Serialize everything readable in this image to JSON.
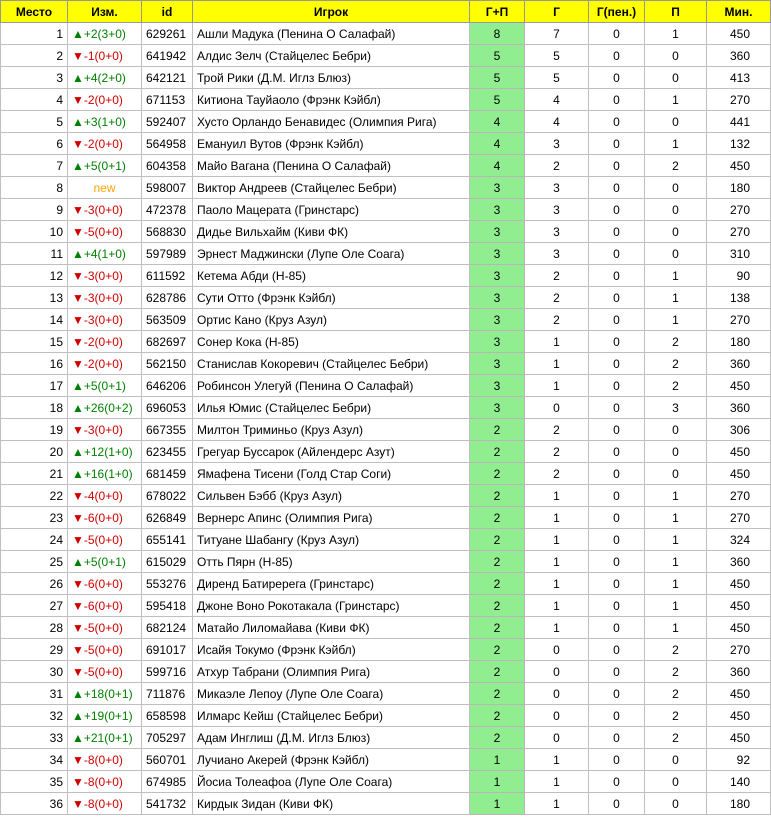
{
  "headers": {
    "place": "Место",
    "change": "Изм.",
    "id": "id",
    "player": "Игрок",
    "gp": "Г+П",
    "g": "Г",
    "gpen": "Г(пен.)",
    "p": "П",
    "min": "Мин."
  },
  "colors": {
    "header_bg": "#ffff00",
    "gp_bg": "#90ee90",
    "up": "#008000",
    "down": "#d00000",
    "new": "#ffa500"
  },
  "rows": [
    {
      "place": "1",
      "dir": "up",
      "change": "▲+2(3+0)",
      "id": "629261",
      "player": "Ашли Мадука (Пенина О Салафай)",
      "gp": "8",
      "g": "7",
      "gpen": "0",
      "p": "1",
      "min": "450"
    },
    {
      "place": "2",
      "dir": "down",
      "change": "▼-1(0+0)",
      "id": "641942",
      "player": "Алдис Зелч (Стайцелес Бебри)",
      "gp": "5",
      "g": "5",
      "gpen": "0",
      "p": "0",
      "min": "360"
    },
    {
      "place": "3",
      "dir": "up",
      "change": "▲+4(2+0)",
      "id": "642121",
      "player": "Трой Рики (Д.М. Иглз Блюз)",
      "gp": "5",
      "g": "5",
      "gpen": "0",
      "p": "0",
      "min": "413"
    },
    {
      "place": "4",
      "dir": "down",
      "change": "▼-2(0+0)",
      "id": "671153",
      "player": "Китиона Тауйаоло (Фрэнк Кэйбл)",
      "gp": "5",
      "g": "4",
      "gpen": "0",
      "p": "1",
      "min": "270"
    },
    {
      "place": "5",
      "dir": "up",
      "change": "▲+3(1+0)",
      "id": "592407",
      "player": "Хусто Орландо Бенавидес (Олимпия Рига)",
      "gp": "4",
      "g": "4",
      "gpen": "0",
      "p": "0",
      "min": "441"
    },
    {
      "place": "6",
      "dir": "down",
      "change": "▼-2(0+0)",
      "id": "564958",
      "player": "Емануил Вутов (Фрэнк Кэйбл)",
      "gp": "4",
      "g": "3",
      "gpen": "0",
      "p": "1",
      "min": "132"
    },
    {
      "place": "7",
      "dir": "up",
      "change": "▲+5(0+1)",
      "id": "604358",
      "player": "Майо Вагана (Пенина О Салафай)",
      "gp": "4",
      "g": "2",
      "gpen": "0",
      "p": "2",
      "min": "450"
    },
    {
      "place": "8",
      "dir": "new",
      "change": "new",
      "id": "598007",
      "player": "Виктор Андреев (Стайцелес Бебри)",
      "gp": "3",
      "g": "3",
      "gpen": "0",
      "p": "0",
      "min": "180"
    },
    {
      "place": "9",
      "dir": "down",
      "change": "▼-3(0+0)",
      "id": "472378",
      "player": "Паоло Мацерата (Гринстарс)",
      "gp": "3",
      "g": "3",
      "gpen": "0",
      "p": "0",
      "min": "270"
    },
    {
      "place": "10",
      "dir": "down",
      "change": "▼-5(0+0)",
      "id": "568830",
      "player": "Дидье Вильхайм (Киви ФК)",
      "gp": "3",
      "g": "3",
      "gpen": "0",
      "p": "0",
      "min": "270"
    },
    {
      "place": "11",
      "dir": "up",
      "change": "▲+4(1+0)",
      "id": "597989",
      "player": "Эрнест Маджински (Лупе Оле Соага)",
      "gp": "3",
      "g": "3",
      "gpen": "0",
      "p": "0",
      "min": "310"
    },
    {
      "place": "12",
      "dir": "down",
      "change": "▼-3(0+0)",
      "id": "611592",
      "player": "Кетема Абди (Н-85)",
      "gp": "3",
      "g": "2",
      "gpen": "0",
      "p": "1",
      "min": "90"
    },
    {
      "place": "13",
      "dir": "down",
      "change": "▼-3(0+0)",
      "id": "628786",
      "player": "Сути Отто (Фрэнк Кэйбл)",
      "gp": "3",
      "g": "2",
      "gpen": "0",
      "p": "1",
      "min": "138"
    },
    {
      "place": "14",
      "dir": "down",
      "change": "▼-3(0+0)",
      "id": "563509",
      "player": "Ортис Кано (Круз Азул)",
      "gp": "3",
      "g": "2",
      "gpen": "0",
      "p": "1",
      "min": "270"
    },
    {
      "place": "15",
      "dir": "down",
      "change": "▼-2(0+0)",
      "id": "682697",
      "player": "Сонер Кока (Н-85)",
      "gp": "3",
      "g": "1",
      "gpen": "0",
      "p": "2",
      "min": "180"
    },
    {
      "place": "16",
      "dir": "down",
      "change": "▼-2(0+0)",
      "id": "562150",
      "player": "Станислав Кокоревич (Стайцелес Бебри)",
      "gp": "3",
      "g": "1",
      "gpen": "0",
      "p": "2",
      "min": "360"
    },
    {
      "place": "17",
      "dir": "up",
      "change": "▲+5(0+1)",
      "id": "646206",
      "player": "Робинсон Улегуй (Пенина О Салафай)",
      "gp": "3",
      "g": "1",
      "gpen": "0",
      "p": "2",
      "min": "450"
    },
    {
      "place": "18",
      "dir": "up",
      "change": "▲+26(0+2)",
      "id": "696053",
      "player": "Илья Юмис (Стайцелес Бебри)",
      "gp": "3",
      "g": "0",
      "gpen": "0",
      "p": "3",
      "min": "360"
    },
    {
      "place": "19",
      "dir": "down",
      "change": "▼-3(0+0)",
      "id": "667355",
      "player": "Милтон Триминьо (Круз Азул)",
      "gp": "2",
      "g": "2",
      "gpen": "0",
      "p": "0",
      "min": "306"
    },
    {
      "place": "20",
      "dir": "up",
      "change": "▲+12(1+0)",
      "id": "623455",
      "player": "Грегуар Буссарок (Айлендерс Азут)",
      "gp": "2",
      "g": "2",
      "gpen": "0",
      "p": "0",
      "min": "450"
    },
    {
      "place": "21",
      "dir": "up",
      "change": "▲+16(1+0)",
      "id": "681459",
      "player": "Ямафена Тисени (Голд Стар Соги)",
      "gp": "2",
      "g": "2",
      "gpen": "0",
      "p": "0",
      "min": "450"
    },
    {
      "place": "22",
      "dir": "down",
      "change": "▼-4(0+0)",
      "id": "678022",
      "player": "Сильвен Бэбб (Круз Азул)",
      "gp": "2",
      "g": "1",
      "gpen": "0",
      "p": "1",
      "min": "270"
    },
    {
      "place": "23",
      "dir": "down",
      "change": "▼-6(0+0)",
      "id": "626849",
      "player": "Вернерс Апинс (Олимпия Рига)",
      "gp": "2",
      "g": "1",
      "gpen": "0",
      "p": "1",
      "min": "270"
    },
    {
      "place": "24",
      "dir": "down",
      "change": "▼-5(0+0)",
      "id": "655141",
      "player": "Титуане Шабангу (Круз Азул)",
      "gp": "2",
      "g": "1",
      "gpen": "0",
      "p": "1",
      "min": "324"
    },
    {
      "place": "25",
      "dir": "up",
      "change": "▲+5(0+1)",
      "id": "615029",
      "player": "Отть Пярн (Н-85)",
      "gp": "2",
      "g": "1",
      "gpen": "0",
      "p": "1",
      "min": "360"
    },
    {
      "place": "26",
      "dir": "down",
      "change": "▼-6(0+0)",
      "id": "553276",
      "player": "Диренд Батиререга (Гринстарс)",
      "gp": "2",
      "g": "1",
      "gpen": "0",
      "p": "1",
      "min": "450"
    },
    {
      "place": "27",
      "dir": "down",
      "change": "▼-6(0+0)",
      "id": "595418",
      "player": "Джоне Воно Рокотакала (Гринстарс)",
      "gp": "2",
      "g": "1",
      "gpen": "0",
      "p": "1",
      "min": "450"
    },
    {
      "place": "28",
      "dir": "down",
      "change": "▼-5(0+0)",
      "id": "682124",
      "player": "Матайо Лиломайава (Киви ФК)",
      "gp": "2",
      "g": "1",
      "gpen": "0",
      "p": "1",
      "min": "450"
    },
    {
      "place": "29",
      "dir": "down",
      "change": "▼-5(0+0)",
      "id": "691017",
      "player": "Исайя Токумо (Фрэнк Кэйбл)",
      "gp": "2",
      "g": "0",
      "gpen": "0",
      "p": "2",
      "min": "270"
    },
    {
      "place": "30",
      "dir": "down",
      "change": "▼-5(0+0)",
      "id": "599716",
      "player": "Атхур Табрани (Олимпия Рига)",
      "gp": "2",
      "g": "0",
      "gpen": "0",
      "p": "2",
      "min": "360"
    },
    {
      "place": "31",
      "dir": "up",
      "change": "▲+18(0+1)",
      "id": "711876",
      "player": "Микаэле Лепоу (Лупе Оле Соага)",
      "gp": "2",
      "g": "0",
      "gpen": "0",
      "p": "2",
      "min": "450"
    },
    {
      "place": "32",
      "dir": "up",
      "change": "▲+19(0+1)",
      "id": "658598",
      "player": "Илмарс Кейш (Стайцелес Бебри)",
      "gp": "2",
      "g": "0",
      "gpen": "0",
      "p": "2",
      "min": "450"
    },
    {
      "place": "33",
      "dir": "up",
      "change": "▲+21(0+1)",
      "id": "705297",
      "player": "Адам Инглиш (Д.М. Иглз Блюз)",
      "gp": "2",
      "g": "0",
      "gpen": "0",
      "p": "2",
      "min": "450"
    },
    {
      "place": "34",
      "dir": "down",
      "change": "▼-8(0+0)",
      "id": "560701",
      "player": "Лучиано Акерей (Фрэнк Кэйбл)",
      "gp": "1",
      "g": "1",
      "gpen": "0",
      "p": "0",
      "min": "92"
    },
    {
      "place": "35",
      "dir": "down",
      "change": "▼-8(0+0)",
      "id": "674985",
      "player": "Йосиа Толеафоа (Лупе Оле Соага)",
      "gp": "1",
      "g": "1",
      "gpen": "0",
      "p": "0",
      "min": "140"
    },
    {
      "place": "36",
      "dir": "down",
      "change": "▼-8(0+0)",
      "id": "541732",
      "player": "Кирдык Зидан (Киви ФК)",
      "gp": "1",
      "g": "1",
      "gpen": "0",
      "p": "0",
      "min": "180"
    }
  ]
}
